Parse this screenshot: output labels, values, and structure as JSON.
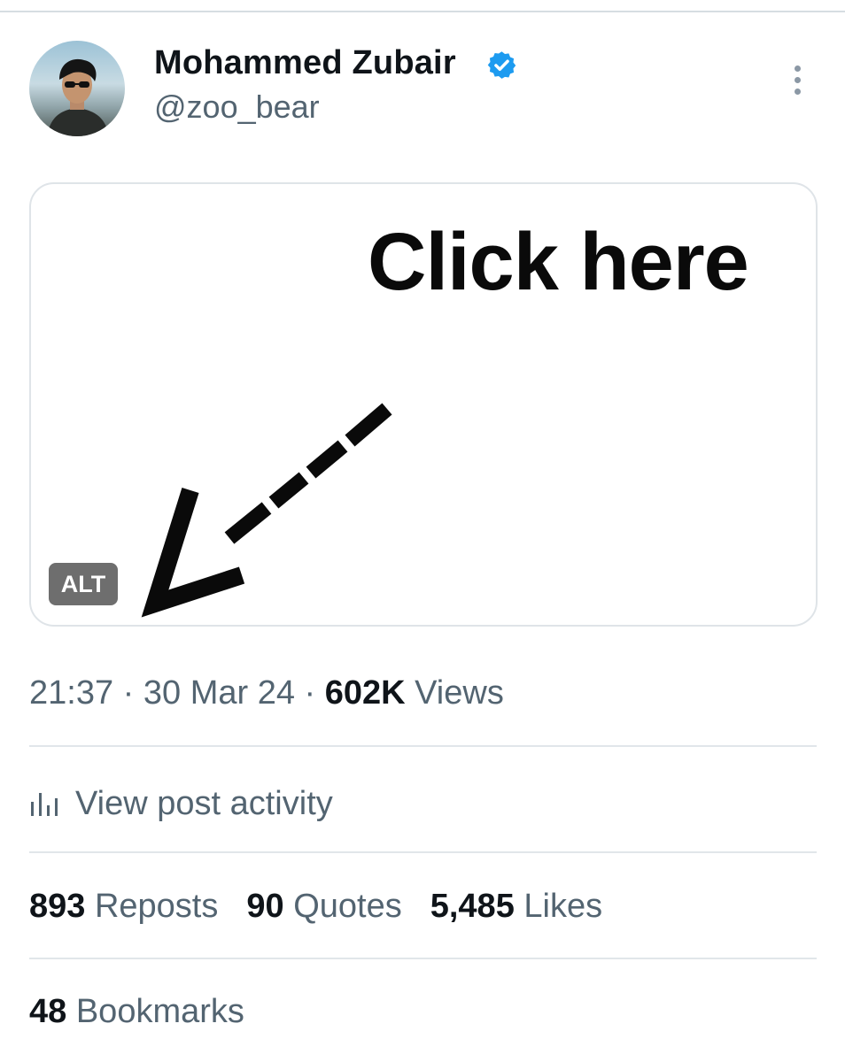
{
  "author": {
    "name": "Mohammed Zubair",
    "handle": "@zoo_bear",
    "verified_color": "#1d9bf0"
  },
  "icons": {
    "verified": "verified-badge-icon",
    "more": "more-vertical-icon",
    "activity": "bar-chart-icon"
  },
  "media": {
    "image_text": "Click here",
    "alt_badge": "ALT"
  },
  "meta": {
    "time": "21:37",
    "sep1": " · ",
    "date": "30 Mar 24",
    "sep2": " · ",
    "views_count": "602K",
    "views_label": " Views"
  },
  "activity": {
    "label": "View post activity"
  },
  "stats": {
    "reposts": {
      "count": "893",
      "label": " Reposts"
    },
    "quotes": {
      "count": "90",
      "label": " Quotes"
    },
    "likes": {
      "count": "5,485",
      "label": " Likes"
    },
    "bookmarks": {
      "count": "48",
      "label": " Bookmarks"
    }
  }
}
